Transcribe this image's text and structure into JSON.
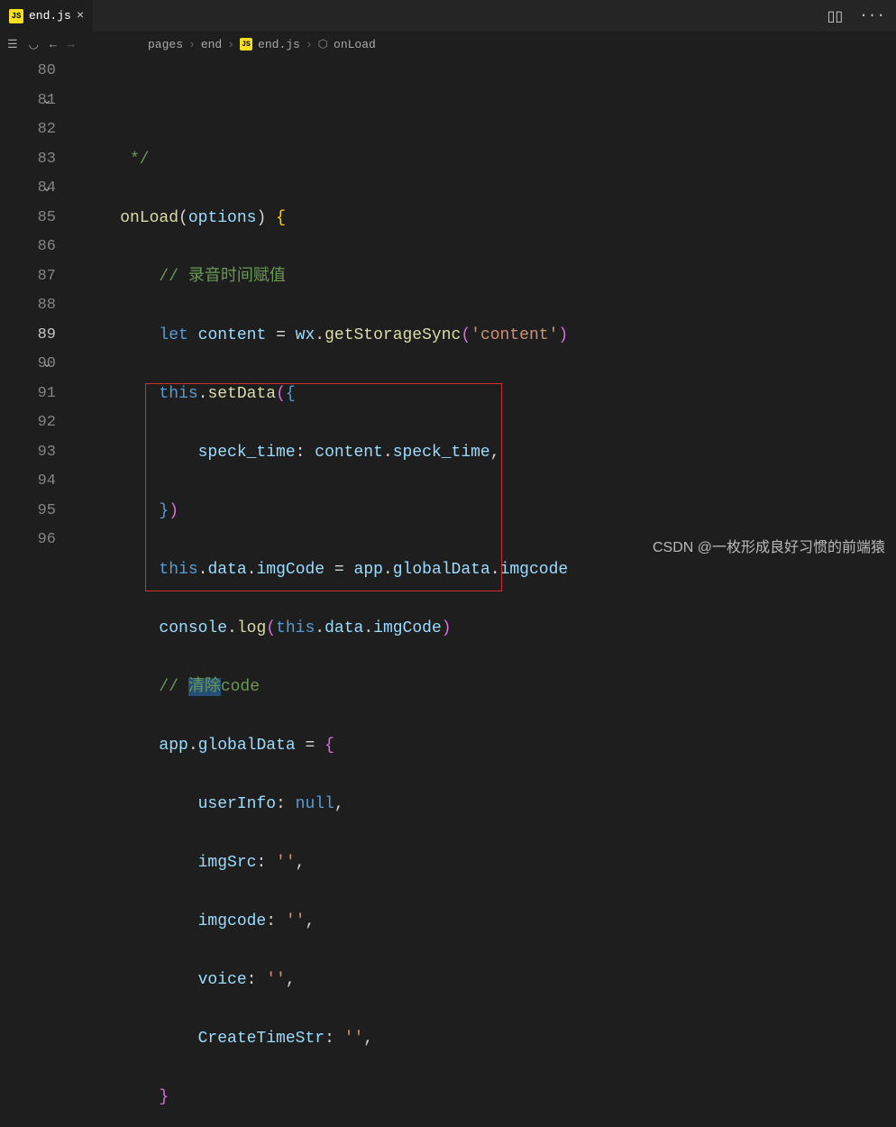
{
  "tab": {
    "icon_label": "JS",
    "filename": "end.js",
    "close": "×"
  },
  "titlebar_actions": {
    "split": "▯▯",
    "more": "···"
  },
  "toolbar": {
    "list_icon": "☰",
    "bookmark_icon": "◡",
    "back_icon": "←",
    "forward_icon": "→"
  },
  "breadcrumb": {
    "seg1": "pages",
    "seg2": "end",
    "seg3_icon": "JS",
    "seg3": "end.js",
    "seg4_icon": "⬡",
    "seg4": "onLoad",
    "sep": "›"
  },
  "gutter": {
    "lines": [
      "",
      "80",
      "81",
      "82",
      "83",
      "84",
      "85",
      "86",
      "87",
      "88",
      "89",
      "90",
      "91",
      "92",
      "93",
      "94",
      "95",
      "96"
    ],
    "current": "89",
    "folds": [
      "81",
      "84",
      "90"
    ]
  },
  "code": {
    "l0_a": "     */",
    "l1_a": "    ",
    "l1_fn": "onLoad",
    "l1_b": "(",
    "l1_param": "options",
    "l1_c": ") ",
    "l1_brace": "{",
    "l2_pad": "        ",
    "l2_comment": "// 录音时间赋值",
    "l3_pad": "        ",
    "l3_let": "let",
    "l3_sp1": " ",
    "l3_var": "content",
    "l3_eq": " = ",
    "l3_wx": "wx",
    "l3_dot": ".",
    "l3_fn": "getStorageSync",
    "l3_p1": "(",
    "l3_str": "'content'",
    "l3_p2": ")",
    "l4_pad": "        ",
    "l4_this": "this",
    "l4_dot": ".",
    "l4_fn": "setData",
    "l4_p1": "(",
    "l4_brace": "{",
    "l5_pad": "            ",
    "l5_prop": "speck_time",
    "l5_colon": ": ",
    "l5_var": "content",
    "l5_dot": ".",
    "l5_prop2": "speck_time",
    "l5_comma": ",",
    "l6_pad": "        ",
    "l6_brace": "}",
    "l6_p": ")",
    "l7_pad": "        ",
    "l7_this": "this",
    "l7_d1": ".",
    "l7_data": "data",
    "l7_d2": ".",
    "l7_img": "imgCode",
    "l7_eq": " = ",
    "l7_app": "app",
    "l7_d3": ".",
    "l7_gd": "globalData",
    "l7_d4": ".",
    "l7_ic": "imgcode",
    "l8_pad": "        ",
    "l8_console": "console",
    "l8_d": ".",
    "l8_log": "log",
    "l8_p1": "(",
    "l8_this": "this",
    "l8_d2": ".",
    "l8_data": "data",
    "l8_d3": ".",
    "l8_img": "imgCode",
    "l8_p2": ")",
    "l9_pad": "        ",
    "l9_slash": "// ",
    "l9_sel": "清除",
    "l9_rest": "code",
    "l10_pad": "        ",
    "l10_app": "app",
    "l10_d": ".",
    "l10_gd": "globalData",
    "l10_eq": " = ",
    "l10_brace": "{",
    "l11_pad": "            ",
    "l11_prop": "userInfo",
    "l11_colon": ": ",
    "l11_null": "null",
    "l11_comma": ",",
    "l12_pad": "            ",
    "l12_prop": "imgSrc",
    "l12_colon": ": ",
    "l12_str": "''",
    "l12_comma": ",",
    "l13_pad": "            ",
    "l13_prop": "imgcode",
    "l13_colon": ": ",
    "l13_str": "''",
    "l13_comma": ",",
    "l14_pad": "            ",
    "l14_prop": "voice",
    "l14_colon": ": ",
    "l14_str": "''",
    "l14_comma": ",",
    "l15_pad": "            ",
    "l15_prop": "CreateTimeStr",
    "l15_colon": ": ",
    "l15_str": "''",
    "l15_comma": ",",
    "l16_pad": "        ",
    "l16_brace": "}"
  },
  "watermark": "CSDN @一枚形成良好习惯的前端猿"
}
